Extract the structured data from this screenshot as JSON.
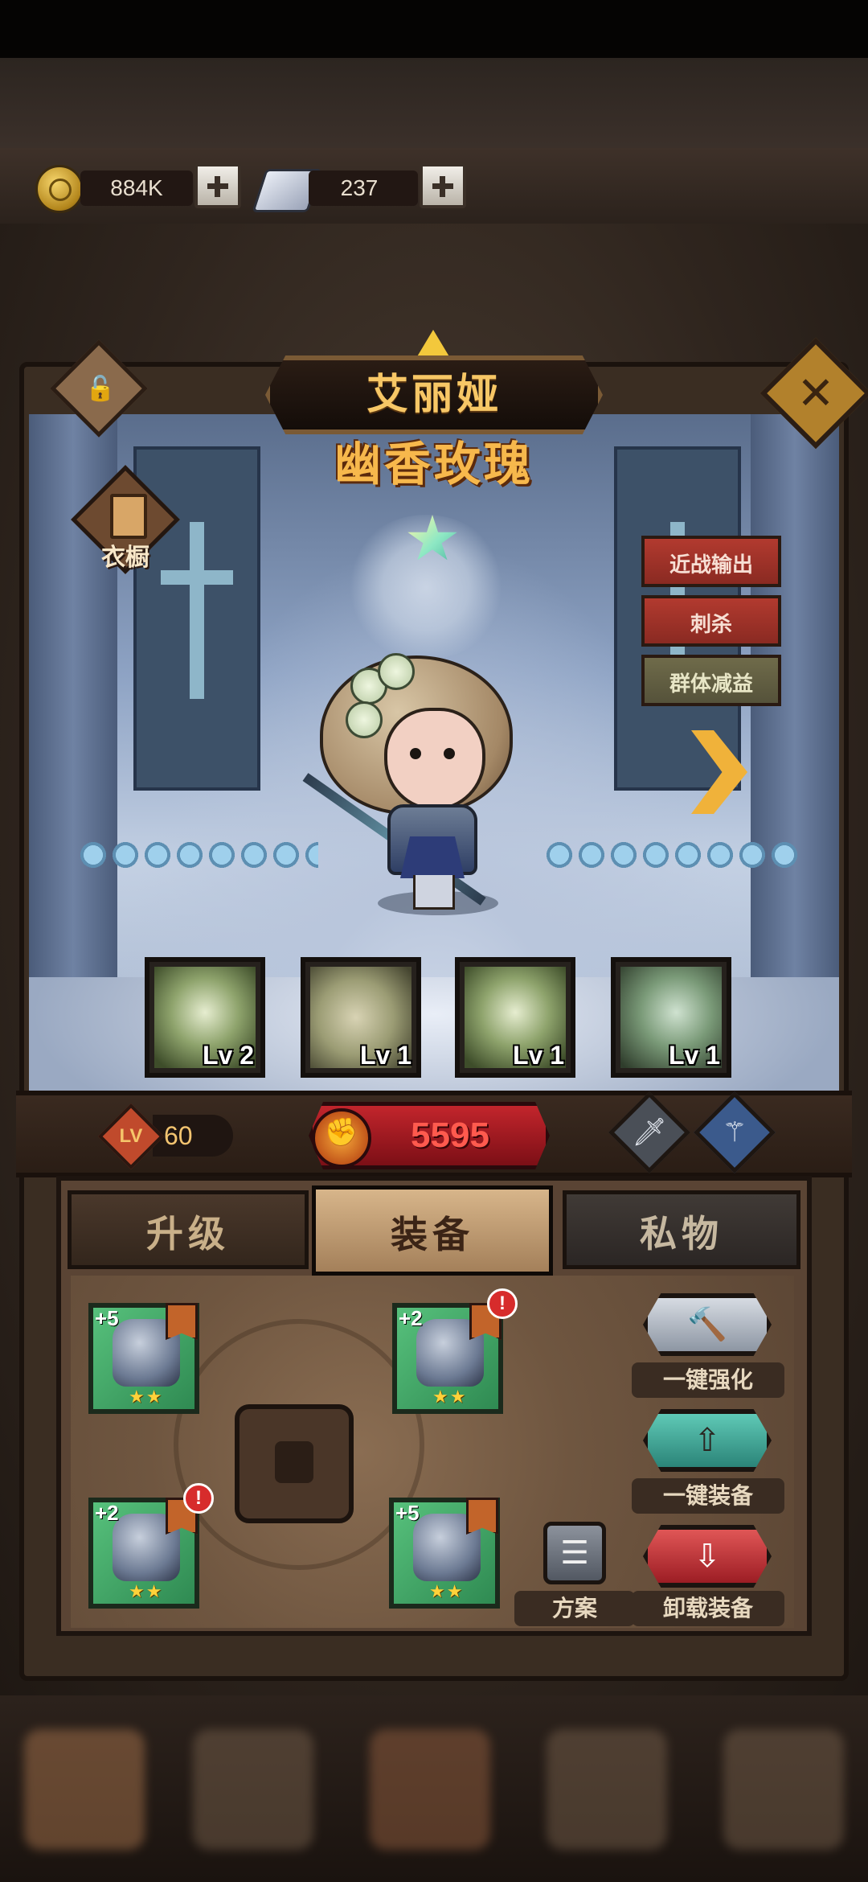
{
  "currency": {
    "gold": "884K",
    "scrolls": "237"
  },
  "hero": {
    "name": "艾丽娅",
    "skin": "幽香玫瑰",
    "wardrobe_label": "衣橱",
    "roles": [
      "近战输出",
      "刺杀",
      "群体减益"
    ],
    "level_badge": "LV",
    "level": "60",
    "power": "5595"
  },
  "skills": [
    {
      "level": "Lv 2"
    },
    {
      "level": "Lv 1"
    },
    {
      "level": "Lv 1"
    },
    {
      "level": "Lv 1"
    }
  ],
  "tabs": {
    "upgrade": "升级",
    "equipment": "装备",
    "private": "私物",
    "active": "装备"
  },
  "equipment": [
    {
      "slot": "helmet",
      "plus": "+5",
      "stars": "★★",
      "alert": false
    },
    {
      "slot": "armor",
      "plus": "+2",
      "stars": "★★",
      "alert": true
    },
    {
      "slot": "gloves",
      "plus": "+2",
      "stars": "★★",
      "alert": true
    },
    {
      "slot": "boots",
      "plus": "+5",
      "stars": "★★",
      "alert": false
    }
  ],
  "actions": {
    "strengthen_all": "一键强化",
    "equip_all": "一键装备",
    "unequip": "卸载装备",
    "plan": "方案"
  },
  "icons": {
    "close": "✕",
    "lock": "🔓",
    "alert": "!"
  },
  "colors": {
    "power_red": "#ff5a4e",
    "title_gold": "#f7c766",
    "equip_green": "#3fa567"
  }
}
